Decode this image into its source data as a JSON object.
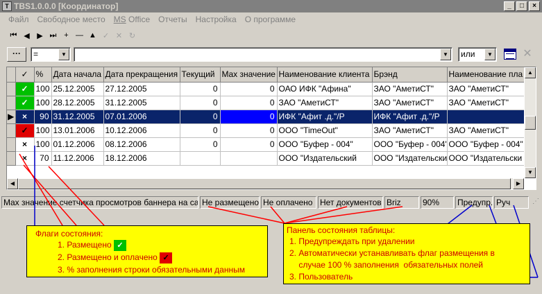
{
  "window": {
    "title": "TBS1.0.0.0 [Координатор]",
    "app_icon": "app-icon",
    "buttons": [
      "_",
      "□",
      "×"
    ]
  },
  "menu": {
    "items": [
      {
        "label": "Файл"
      },
      {
        "label": "Свободное место"
      },
      {
        "label_u": "MS",
        "label_rest": " Office"
      },
      {
        "label": "Отчеты"
      },
      {
        "label": "Настройка"
      },
      {
        "label": "О программе"
      }
    ]
  },
  "toolbar": {
    "buttons": [
      {
        "icon": "first-record-icon",
        "glyph": "⏮",
        "enabled": true
      },
      {
        "icon": "prev-record-icon",
        "glyph": "◀",
        "enabled": true
      },
      {
        "icon": "next-record-icon",
        "glyph": "▶",
        "enabled": true
      },
      {
        "icon": "last-record-icon",
        "glyph": "⏭",
        "enabled": true
      },
      {
        "icon": "add-record-icon",
        "glyph": "+",
        "enabled": true
      },
      {
        "icon": "delete-record-icon",
        "glyph": "—",
        "enabled": true
      },
      {
        "icon": "edit-record-icon",
        "glyph": "▲",
        "enabled": true
      },
      {
        "icon": "post-record-icon",
        "glyph": "✓",
        "enabled": false
      },
      {
        "icon": "cancel-record-icon",
        "glyph": "✕",
        "enabled": false
      },
      {
        "icon": "refresh-icon",
        "glyph": "↻",
        "enabled": false
      }
    ]
  },
  "filter": {
    "field_button": "···",
    "operator": "=",
    "value": "",
    "logic": "или"
  },
  "grid": {
    "columns": [
      "",
      "%",
      "Дата начала",
      "Дата прекращения",
      "Текущий",
      "Max значение",
      "Наименование клиента",
      "Брэнд",
      "Наименование пла"
    ],
    "header_check": "✓",
    "rows": [
      {
        "indicator": "",
        "flag": "green",
        "flag_glyph": "✓",
        "pct": "100",
        "start": "25.12.2005",
        "end": "27.12.2005",
        "current": "0",
        "max": "0",
        "client": "ОАО ИФК  \"Афина\"",
        "brand": "ЗАО \"АметиСТ\"",
        "placement": "ЗАО \"АметиСТ\"",
        "selected": false
      },
      {
        "indicator": "",
        "flag": "green",
        "flag_glyph": "✓",
        "pct": "100",
        "start": "28.12.2005",
        "end": "31.12.2005",
        "current": "0",
        "max": "0",
        "client": "ЗАО \"АметиСТ\"",
        "brand": "ЗАО \"АметиСТ\"",
        "placement": "ЗАО \"АметиСТ\"",
        "selected": false
      },
      {
        "indicator": "▶",
        "flag": "none",
        "flag_glyph": "×",
        "pct": "90",
        "start": "31.12.2005",
        "end": "07.01.2006",
        "current": "0",
        "max": "0",
        "client": "ИФК  \"Афит .д.\"/Р",
        "brand": "ИФК  \"Афит .д.\"/Р",
        "placement": "",
        "selected": true
      },
      {
        "indicator": "",
        "flag": "red",
        "flag_glyph": "✓",
        "pct": "100",
        "start": "13.01.2006",
        "end": "10.12.2006",
        "current": "0",
        "max": "0",
        "client": "ООО \"TimeOut\"",
        "brand": "ЗАО \"АметиСТ\"",
        "placement": "ЗАО \"АметиСТ\"",
        "selected": false
      },
      {
        "indicator": "",
        "flag": "none",
        "flag_glyph": "×",
        "pct": "100",
        "start": "01.12.2006",
        "end": "08.12.2006",
        "current": "0",
        "max": "0",
        "client": "ООО \"Буфер - 004\"",
        "brand": "ООО \"Буфер - 004\"",
        "placement": "ООО \"Буфер - 004\"",
        "selected": false
      },
      {
        "indicator": "",
        "flag": "none",
        "flag_glyph": "×",
        "pct": "70",
        "start": "11.12.2006",
        "end": "18.12.2006",
        "current": "",
        "max": "",
        "client": "ООО \"Издательский",
        "brand": "ООО \"Издательски",
        "placement": "ООО \"Издательски",
        "selected": false
      }
    ]
  },
  "statusbar": {
    "panels": [
      "Max значение счетчика просмотров баннера на са",
      "Не размещено",
      "Не оплачено",
      "Нет документов",
      "Briz",
      "90%",
      "Предупр.",
      "Руч"
    ]
  },
  "annotations": {
    "flags_title": "Флаги состояния:",
    "flags_items": [
      "1. Размещено",
      "2. Размещено и оплачено",
      "3. % заполнения строки обязательными данным"
    ],
    "status_title": "Панель состояния таблицы:",
    "status_items": [
      "1. Предупреждать при удалении",
      "2. Автоматически устанавливать флаг размещения в",
      "    случае 100 % заполнения  обязательных полей",
      "3. Пользователь"
    ]
  },
  "colors": {
    "selection": "#0a246a",
    "flag_green": "#00c000",
    "flag_red": "#e00000",
    "note_bg": "#ffff00",
    "note_red_text": "#cc0000",
    "note_blue_text": "#000080"
  }
}
